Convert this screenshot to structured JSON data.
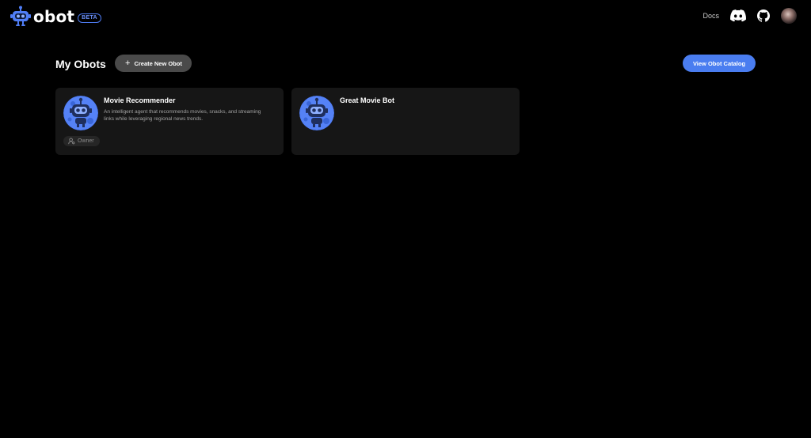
{
  "header": {
    "logo_text": "obot",
    "beta_label": "BETA",
    "docs_label": "Docs",
    "icons": {
      "logo": "robot-logo-icon",
      "discord": "discord-icon",
      "github": "github-icon",
      "avatar": "user-avatar"
    }
  },
  "main": {
    "title": "My Obots",
    "create_button_label": "Create New Obot",
    "catalog_button_label": "View Obot Catalog"
  },
  "cards": [
    {
      "title": "Movie Recommender",
      "description": "An intelligent agent that recommends movies, snacks, and streaming links while leveraging regional news trends.",
      "badge": "Owner"
    },
    {
      "title": "Great Movie Bot"
    }
  ],
  "colors": {
    "background": "#000000",
    "card": "#161616",
    "accent": "#4a7df0",
    "create_button": "#4a4a4a",
    "bot_blue": "#4f7df5"
  }
}
